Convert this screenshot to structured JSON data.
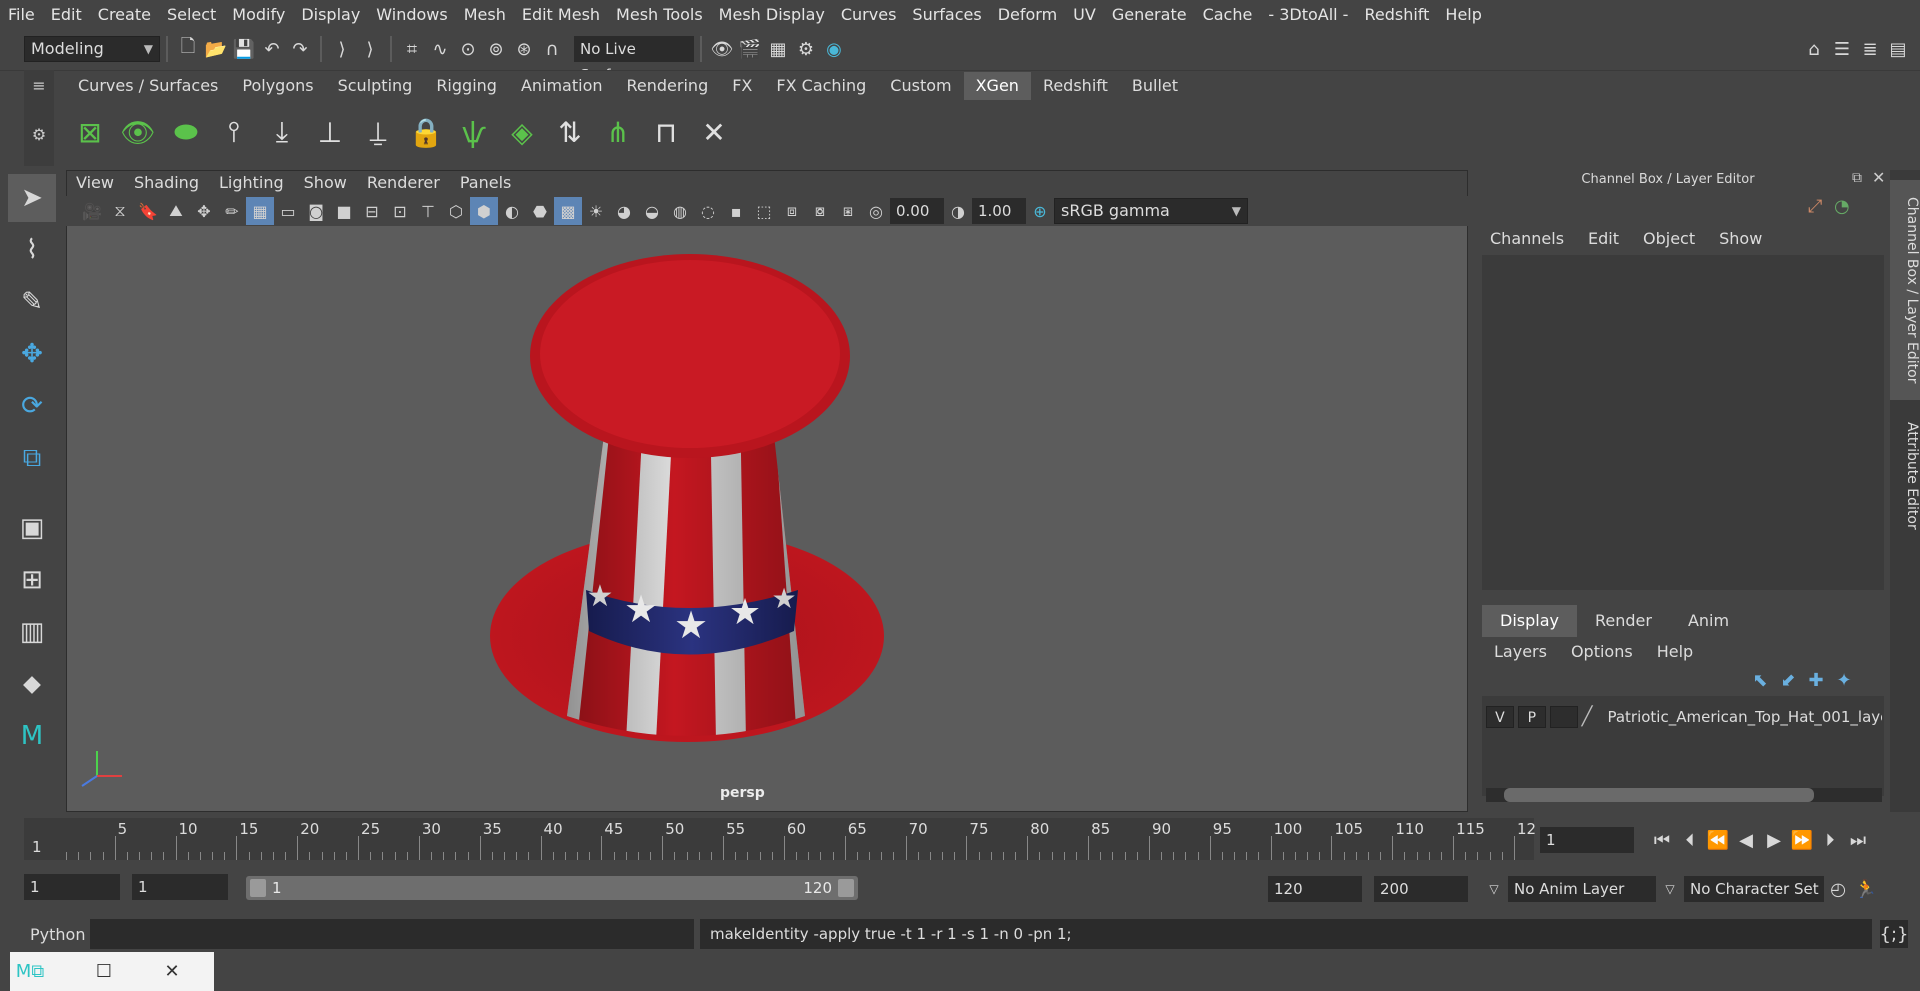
{
  "menu": [
    "File",
    "Edit",
    "Create",
    "Select",
    "Modify",
    "Display",
    "Windows",
    "Mesh",
    "Edit Mesh",
    "Mesh Tools",
    "Mesh Display",
    "Curves",
    "Surfaces",
    "Deform",
    "UV",
    "Generate",
    "Cache",
    "- 3DtoAll -",
    "Redshift",
    "Help"
  ],
  "status": {
    "mode": "Modeling",
    "live_surface": "No Live Surface"
  },
  "shelf_tabs": [
    "Curves / Surfaces",
    "Polygons",
    "Sculpting",
    "Rigging",
    "Animation",
    "Rendering",
    "FX",
    "FX Caching",
    "Custom",
    "XGen",
    "Redshift",
    "Bullet"
  ],
  "shelf_active": "XGen",
  "panel_menu": [
    "View",
    "Shading",
    "Lighting",
    "Show",
    "Renderer",
    "Panels"
  ],
  "panel_toolbar": {
    "exposure": "0.00",
    "gamma": "1.00",
    "color_space": "sRGB gamma"
  },
  "viewport": {
    "camera": "persp"
  },
  "channel_box": {
    "title": "Channel Box / Layer Editor",
    "menu": [
      "Channels",
      "Edit",
      "Object",
      "Show"
    ]
  },
  "layer_editor": {
    "tabs": [
      "Display",
      "Render",
      "Anim"
    ],
    "active_tab": "Display",
    "menu": [
      "Layers",
      "Options",
      "Help"
    ],
    "layer": {
      "v": "V",
      "p": "P",
      "name": "Patriotic_American_Top_Hat_001_laye"
    }
  },
  "side_tabs": [
    "Channel Box / Layer Editor",
    "Attribute Editor"
  ],
  "timeline": {
    "ticks": [
      "5",
      "10",
      "15",
      "20",
      "25",
      "30",
      "35",
      "40",
      "45",
      "50",
      "55",
      "60",
      "65",
      "70",
      "75",
      "80",
      "85",
      "90",
      "95",
      "100",
      "105",
      "110",
      "115",
      "12"
    ],
    "start_label": "1",
    "current_frame": "1"
  },
  "range": {
    "start": "1",
    "playback_start": "1",
    "slider_start": "1",
    "slider_end": "120",
    "playback_end": "120",
    "end": "200",
    "anim_layer": "No Anim Layer",
    "char_set": "No Character Set"
  },
  "cmdline": {
    "lang": "Python",
    "result": "makeIdentity -apply true -t 1 -r 1 -s 1 -n 0 -pn 1;"
  }
}
